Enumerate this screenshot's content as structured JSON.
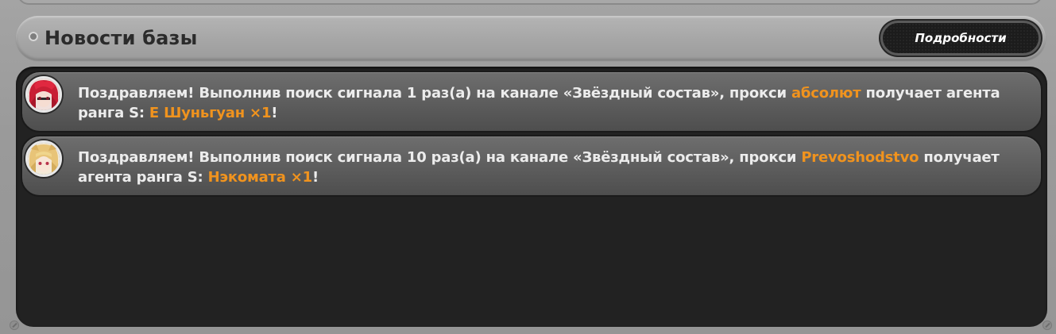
{
  "section": {
    "title": "Новости базы",
    "details_button": "Подробности"
  },
  "news": [
    {
      "avatar": "red-haired-character-avatar",
      "prefix": "Поздравляем! Выполнив поиск сигнала 1 раз(а) на канале «Звёздный состав», прокси ",
      "player": "абсолют",
      "middle": " получает агента ранга S: ",
      "agent": "Е Шуньгуан ×1",
      "suffix": "!"
    },
    {
      "avatar": "blonde-character-avatar",
      "prefix": "Поздравляем! Выполнив поиск сигнала 10 раз(а) на канале «Звёздный состав», прокси ",
      "player": "Prevoshodstvo",
      "middle": " получает агента ранга S: ",
      "agent": "Нэкомата ×1",
      "suffix": "!"
    }
  ],
  "colors": {
    "highlight": "#f0931e",
    "text": "#ececec",
    "panel": "#222222"
  }
}
